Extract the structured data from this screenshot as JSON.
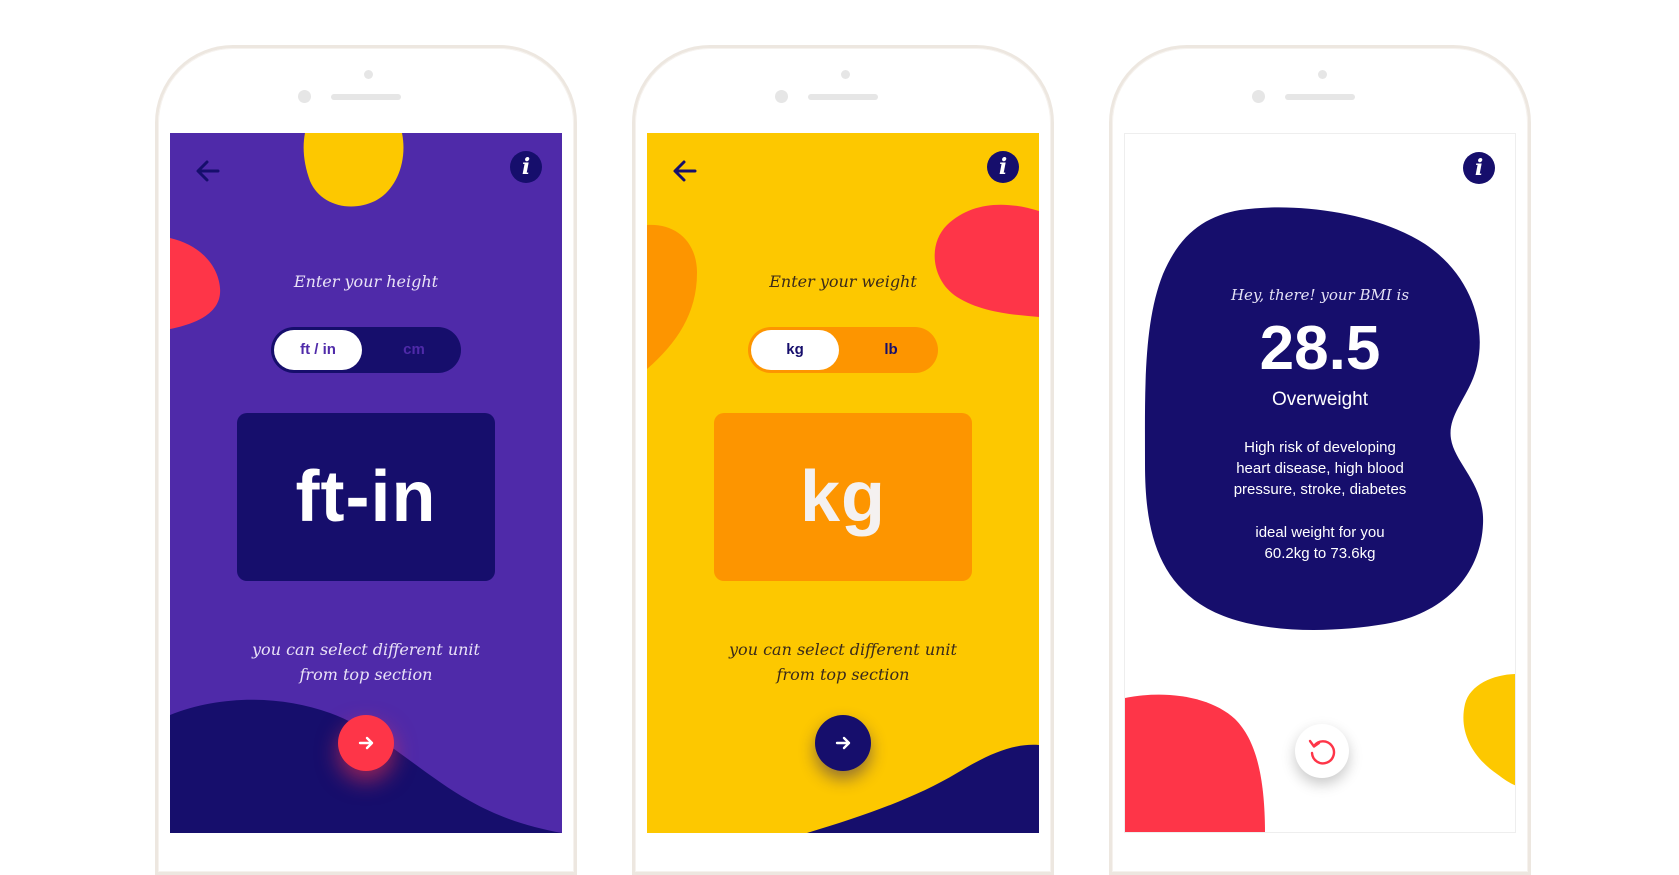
{
  "colors": {
    "purple": "#4f2aa9",
    "navy": "#160e6c",
    "yellow": "#fdc800",
    "orange": "#fd9500",
    "coral": "#fe3548",
    "white": "#ffffff"
  },
  "icons": {
    "back": "arrow-left-icon",
    "info": "info-icon",
    "next": "arrow-right-icon",
    "reset": "refresh-icon"
  },
  "height_screen": {
    "info_label": "i",
    "prompt": "Enter your height",
    "toggle": {
      "selected": "ft / in",
      "other": "cm"
    },
    "unit_display": "ft-in",
    "hint_line1": "you can select different unit",
    "hint_line2": "from top section"
  },
  "weight_screen": {
    "info_label": "i",
    "prompt": "Enter your weight",
    "toggle": {
      "selected": "kg",
      "other": "lb"
    },
    "unit_display": "kg",
    "hint_line1": "you can select different unit",
    "hint_line2": "from top section"
  },
  "result_screen": {
    "info_label": "i",
    "greeting": "Hey, there! your BMI is",
    "bmi_value": "28.5",
    "category": "Overweight",
    "risk_line1": "High risk of developing",
    "risk_line2": "heart disease, high blood",
    "risk_line3": "pressure, stroke, diabetes",
    "ideal_line1": "ideal weight for you",
    "ideal_line2": "60.2kg to 73.6kg"
  }
}
